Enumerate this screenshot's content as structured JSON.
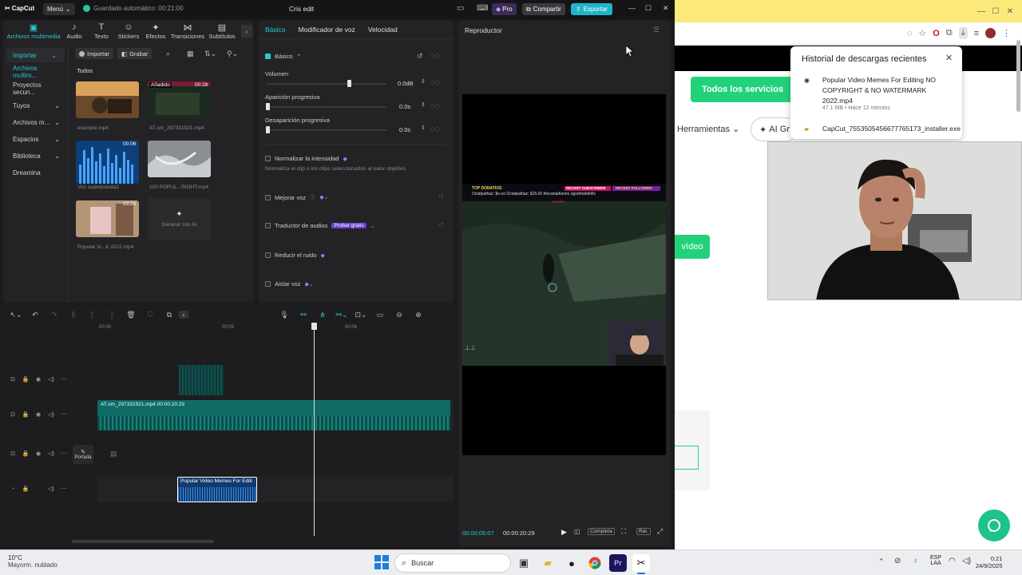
{
  "browser": {
    "services_btn": "Todos los servicios",
    "herramientas": "Herramientas",
    "ai_chip": "AI Gr",
    "video_btn": "vídeo",
    "downloads": {
      "title": "Historial de descargas recientes",
      "items": [
        {
          "name": "Popular Video Memes For Editing NO COPYRIGHT & NO WATERMARK 2022.mp4",
          "meta": "47.1 MB • Hace 12 minutos"
        },
        {
          "name": "CapCut_7553505456677765173_installer.exe",
          "meta": ""
        }
      ]
    }
  },
  "capcut": {
    "title": "Cris edit",
    "menu": "Menú",
    "autosave": "Guardado automático: 00:21:00",
    "pro": "Pro",
    "share": "Compartir",
    "export": "Exportar",
    "tabs": [
      {
        "label": "Archivos multimedia",
        "icon": "▣"
      },
      {
        "label": "Audio",
        "icon": "♪"
      },
      {
        "label": "Texto",
        "icon": "T"
      },
      {
        "label": "Stickers",
        "icon": "☺"
      },
      {
        "label": "Efectos",
        "icon": "✦"
      },
      {
        "label": "Transiciones",
        "icon": "⋈"
      },
      {
        "label": "Subtítulos",
        "icon": "▤"
      }
    ],
    "sidebar": [
      {
        "label": "Importar"
      },
      {
        "label": "Archivos multim..."
      },
      {
        "label": "Proyectos secun..."
      },
      {
        "label": "Tuyos"
      },
      {
        "label": "Archivos m..."
      },
      {
        "label": "Espacios"
      },
      {
        "label": "Biblioteca"
      },
      {
        "label": "Dreamina"
      }
    ],
    "media": {
      "import_btn": "Importar",
      "record_btn": "Grabar",
      "filter_all": "Todos",
      "items": [
        {
          "name": "example.mp4",
          "badge": ""
        },
        {
          "name": "AT-cm_297331921.mp4",
          "badge": "00:28",
          "added": "Añadido"
        },
        {
          "name": "Voz superpuesta1",
          "badge": "00:06"
        },
        {
          "name": "100 POPUL...RIGHT.mp4",
          "badge": ""
        },
        {
          "name": "Popular Vi...K 2022.mp4",
          "badge": "03:26"
        }
      ],
      "generate": "Generar con IA"
    },
    "props": {
      "tabs": [
        "Básico",
        "Modificador de voz",
        "Velocidad"
      ],
      "section": "Básico",
      "volume_label": "Volumen",
      "volume_value": "0.0dB",
      "fadein_label": "Aparición progresiva",
      "fadein_value": "0.0s",
      "fadeout_label": "Desaparición progresiva",
      "fadeout_value": "0.0s",
      "normalize_label": "Normalizar la intensidad",
      "normalize_desc": "Normaliza el clip o los clips seleccionados al valor objetivo.",
      "enhance_label": "Mejorar voz",
      "translator_label": "Traductor de audios",
      "translator_badge": "Probar gratis",
      "noise_label": "Reducir el ruido",
      "isolate_label": "Aislar voz"
    },
    "player": {
      "title": "Reproductor",
      "current_time": "00:00:05:07",
      "total_time": "00:00:20:29",
      "full": "Completa",
      "ratio": "Rel.",
      "overlay": {
        "top": "TOP DONATIOS",
        "recent1": "RECENT SUBSCRIBER",
        "recent2": "RECENT FOLLOWER",
        "line": "Octalpathaz: $n.oo  Octalpathaz: $15.00  thecanadiannu  ogodmahdrills",
        "pink": "Mundial"
      }
    },
    "timeline": {
      "ticks": [
        "00:00",
        "00:03",
        "00:06"
      ],
      "clip_main": "AT-cm_297331921.mp4  00:00:20:29",
      "clip_audio": "Popular Video Memes For Editi",
      "cover": "Portada"
    }
  },
  "webcam_label": "",
  "taskbar": {
    "temp": "10°C",
    "weather": "Mayorm. nublado",
    "search": "Buscar",
    "lang1": "ESP",
    "lang2": "LAA",
    "time": "0:21",
    "date": "24/9/2025"
  }
}
